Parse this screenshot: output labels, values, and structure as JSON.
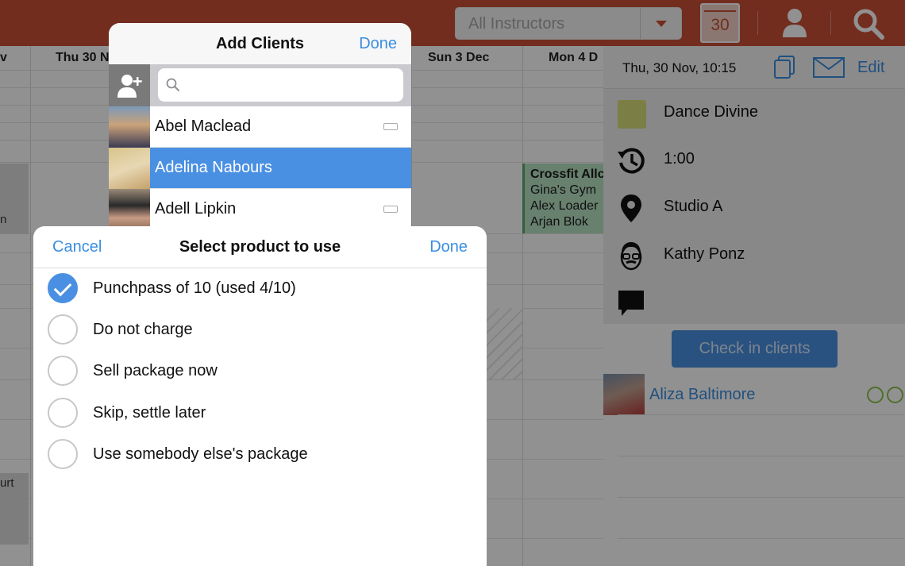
{
  "topbar": {
    "instructor_select": "All Instructors",
    "calendar_day": "30"
  },
  "calendar": {
    "days": [
      "v",
      "Thu 30 N",
      "Sun 3 Dec",
      "Mon 4 D"
    ],
    "side_fragments": [
      "n",
      "urt"
    ],
    "event": {
      "title": "Crossfit Allc",
      "lines": [
        "Gina's Gym",
        "Alex Loader",
        "Arjan Blok"
      ]
    }
  },
  "detail": {
    "datetime": "Thu, 30 Nov, 10:15",
    "edit_label": "Edit",
    "class_name": "Dance Divine",
    "class_color": "#d9e07a",
    "duration": "1:00",
    "location": "Studio A",
    "instructor": "Kathy Ponz",
    "note": "",
    "checkin_label": "Check in clients",
    "client": "Aliza Baltimore"
  },
  "add_clients": {
    "title": "Add Clients",
    "done_label": "Done",
    "search_placeholder": "",
    "clients": [
      {
        "name": "Abel Maclead",
        "selected": false
      },
      {
        "name": "Adelina Nabours",
        "selected": true
      },
      {
        "name": "Adell Lipkin",
        "selected": false
      }
    ]
  },
  "product_sheet": {
    "cancel_label": "Cancel",
    "title": "Select product to use",
    "done_label": "Done",
    "options": [
      {
        "label": "Punchpass of 10 (used 4/10)",
        "checked": true
      },
      {
        "label": "Do not charge",
        "checked": false
      },
      {
        "label": "Sell package now",
        "checked": false
      },
      {
        "label": "Skip, settle later",
        "checked": false
      },
      {
        "label": "Use somebody else's package",
        "checked": false
      }
    ]
  },
  "colors": {
    "topbar": "#c94f36",
    "accent": "#4a90e2",
    "event_bg": "#b8e2c2"
  }
}
